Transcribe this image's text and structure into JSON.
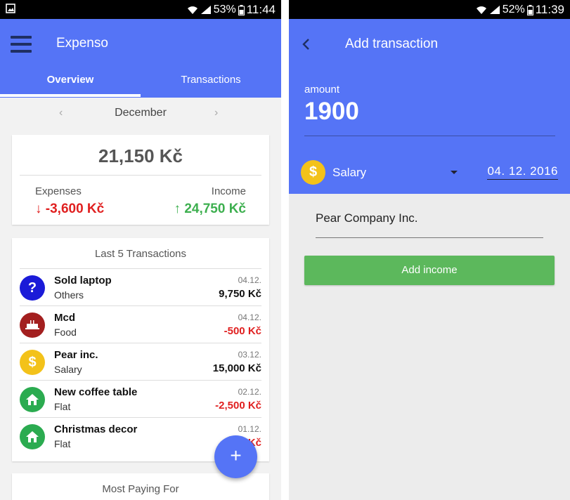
{
  "left_screen": {
    "statusbar": {
      "battery": "53%",
      "time": "11:44"
    },
    "app_title": "Expenso",
    "tabs": [
      {
        "label": "Overview"
      },
      {
        "label": "Transactions"
      }
    ],
    "month": "December",
    "summary": {
      "balance": "21,150 Kč",
      "expenses_label": "Expenses",
      "expenses_value": "-3,600 Kč",
      "income_label": "Income",
      "income_value": "24,750 Kč"
    },
    "last_transactions": {
      "title": "Last 5 Transactions",
      "items": [
        {
          "name": "Sold laptop",
          "category": "Others",
          "date": "04.12.",
          "amount": "9,750 Kč",
          "sign": "positive",
          "icon": "question-icon",
          "icon_color": "#1b1bd8"
        },
        {
          "name": "Mcd",
          "category": "Food",
          "date": "04.12.",
          "amount": "-500 Kč",
          "sign": "negative",
          "icon": "food-icon",
          "icon_color": "#a31f1f"
        },
        {
          "name": "Pear inc.",
          "category": "Salary",
          "date": "03.12.",
          "amount": "15,000 Kč",
          "sign": "positive",
          "icon": "dollar-icon",
          "icon_color": "#f3c21a"
        },
        {
          "name": "New coffee table",
          "category": "Flat",
          "date": "02.12.",
          "amount": "-2,500 Kč",
          "sign": "negative",
          "icon": "house-icon",
          "icon_color": "#2bab50"
        },
        {
          "name": "Christmas decor",
          "category": "Flat",
          "date": "01.12.",
          "amount": "Kč",
          "sign": "negative",
          "icon": "house-icon",
          "icon_color": "#2bab50"
        }
      ]
    },
    "fab_label": "+",
    "most_paying_title": "Most Paying For"
  },
  "right_screen": {
    "statusbar": {
      "battery": "52%",
      "time": "11:39"
    },
    "title": "Add transaction",
    "amount_label": "amount",
    "amount_value": "1900",
    "category": "Salary",
    "category_icon": "dollar-icon",
    "date": "04. 12. 2016",
    "description": "Pear Company Inc.",
    "submit_label": "Add income"
  },
  "colors": {
    "primary": "#5574f6",
    "negative": "#e02020",
    "positive": "#3daf4f",
    "button_green": "#5cb85c"
  }
}
